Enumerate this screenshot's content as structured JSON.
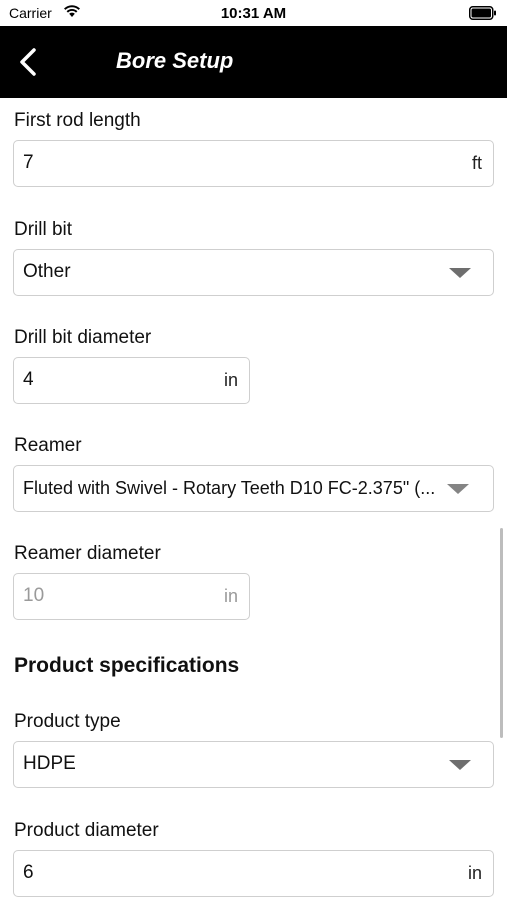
{
  "status": {
    "carrier": "Carrier",
    "time": "10:31 AM",
    "wifi_icon": "wifi-icon",
    "battery_icon": "battery-icon"
  },
  "nav": {
    "title": "Bore Setup",
    "back_icon": "chevron-left-icon"
  },
  "form": {
    "first_rod_length": {
      "label": "First rod length",
      "value": "7",
      "unit": "ft"
    },
    "drill_bit": {
      "label": "Drill bit",
      "value": "Other"
    },
    "drill_bit_diameter": {
      "label": "Drill bit diameter",
      "value": "4",
      "unit": "in"
    },
    "reamer": {
      "label": "Reamer",
      "value": "Fluted with Swivel - Rotary Teeth D10 FC-2.375\" (..."
    },
    "reamer_diameter": {
      "label": "Reamer diameter",
      "placeholder": "10",
      "unit": "in"
    },
    "product_section": {
      "title": "Product specifications"
    },
    "product_type": {
      "label": "Product type",
      "value": "HDPE"
    },
    "product_diameter": {
      "label": "Product diameter",
      "value": "6",
      "unit": "in"
    }
  }
}
